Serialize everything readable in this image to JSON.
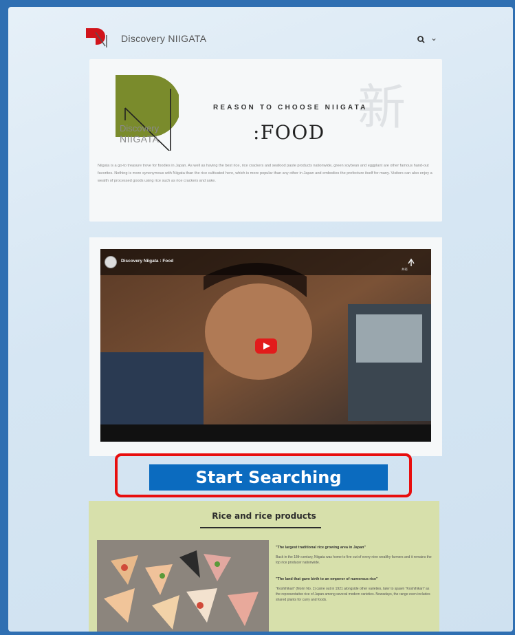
{
  "header": {
    "title": "Discovery NIIGATA",
    "search_icon": "search-icon",
    "menu_icon": "chevron-down-icon"
  },
  "banner": {
    "brand_line1": "Discovery",
    "brand_line2": "NIIGATA",
    "tagline": "REASON TO CHOOSE NIIGATA",
    "title": ":FOOD",
    "kanji": "新",
    "description": "Niigata is a go-to treasure trove for foodies in Japan. As well as having the best rice, rice crackers and seafood paste products nationwide, green soybean and eggplant are other famous hand-out favorites. Nothing is more synonymous with Niigata than the rice cultivated here, which is more popular than any other in Japan and embodies the prefecture itself for many. Visitors can also enjoy a wealth of processed goods using rice such as rice crackers and sake."
  },
  "video": {
    "title": "Discovery Niigata : Food",
    "share_label": "共有"
  },
  "cta": {
    "label": "Start Searching"
  },
  "section": {
    "title": "Rice and rice products",
    "items": [
      {
        "heading": "\"The largest traditional rice growing area in Japan\"",
        "body": "Back in the 18th century, Niigata was home to five out of every nine wealthy farmers and it remains the top rice producer nationwide."
      },
      {
        "heading": "\"The land that gave birth to an emperor of numerous rice\"",
        "body": "\"Koshihikari\" (Norin No. 1) came out in 1921 alongside other varieties, later to spawn \"Koshihikari\" as the representative rice of Japan among several modern varieties. Nowadays, the range even includes shared plants for curry and foods."
      }
    ]
  },
  "colors": {
    "frame": "#2f6fb2",
    "cta": "#0b6bbf",
    "highlight": "#e80e0e",
    "section_bg": "#d7e0ab",
    "brand_green": "#7a8b2c",
    "logo_red": "#d1141b"
  }
}
